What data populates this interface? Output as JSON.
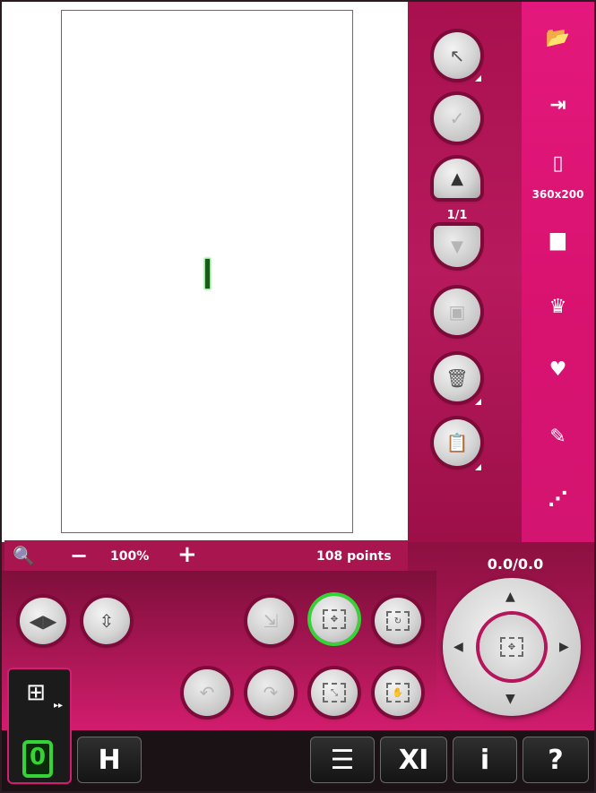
{
  "colors": {
    "accent": "#d8126f",
    "panel": "#a9104e",
    "selection_ring": "#35d335"
  },
  "canvas": {
    "cursor_label": "I"
  },
  "pager": {
    "label": "1/1"
  },
  "right_toolbar": {
    "items": [
      {
        "icon": "folder-load-icon"
      },
      {
        "icon": "center-stitch-icon"
      },
      {
        "icon": "hoop-icon",
        "label": "360x200"
      },
      {
        "icon": "thread-spool-icon"
      },
      {
        "icon": "crown-shape-icon"
      },
      {
        "icon": "heart-stitch-icon"
      },
      {
        "icon": "abc-stitch-icon"
      },
      {
        "icon": "edit-stitch-icon"
      }
    ]
  },
  "mid_buttons": [
    {
      "icon": "select-pointer-icon"
    },
    {
      "icon": "edit-check-icon"
    },
    {
      "icon": "page-up-icon"
    },
    {
      "icon": "page-down-icon"
    },
    {
      "icon": "layer-icon"
    },
    {
      "icon": "trash-icon"
    },
    {
      "icon": "paste-icon"
    }
  ],
  "zoom": {
    "zoom_tool_icon": "zoom-tool-icon",
    "minus": "−",
    "value": "100%",
    "plus": "+",
    "points": "108 points"
  },
  "coords": {
    "value": "0.0/0.0"
  },
  "bottom_buttons": [
    {
      "icon": "mirror-horizontal-icon"
    },
    {
      "icon": "mirror-vertical-icon"
    },
    {
      "icon": "move-to-hoop-icon"
    },
    {
      "icon": "move-icon"
    },
    {
      "icon": "rotate-icon"
    },
    {
      "icon": "undo-icon"
    },
    {
      "icon": "redo-icon"
    },
    {
      "icon": "resize-icon"
    },
    {
      "icon": "pan-hand-icon"
    }
  ],
  "taskbar": {
    "mode_digit": "0",
    "presser_foot": "H",
    "menu_glyph": "☰",
    "tools_glyph": "Ⅺ",
    "info_glyph": "i",
    "help_glyph": "?"
  }
}
